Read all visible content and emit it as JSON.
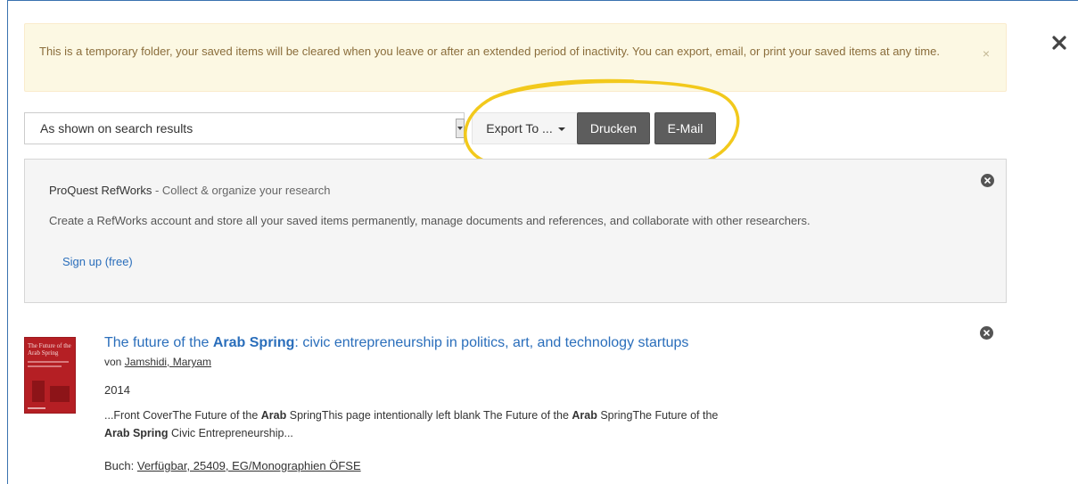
{
  "notice": {
    "text": "This is a temporary folder, your saved items will be cleared when you leave or after an extended period of inactivity. You can export, email, or print your saved items at any time.",
    "dismiss_glyph": "×"
  },
  "toolbar": {
    "format_selected": "As shown on search results",
    "export_label": "Export To ...",
    "print_label": "Drucken",
    "email_label": "E-Mail"
  },
  "refworks": {
    "brand": "ProQuest RefWorks",
    "tagline": " - Collect & organize your research",
    "description": "Create a RefWorks account and store all your saved items permanently, manage documents and references, and collaborate with other researchers.",
    "signup_label": "Sign up (free)"
  },
  "result": {
    "cover_text": "The Future of the Arab Spring",
    "title_pre": "The future of the ",
    "title_highlight": "Arab Spring",
    "title_post": ": civic entrepreneurship in politics, art, and technology startups",
    "author_prefix": "von ",
    "author": "Jamshidi, Maryam",
    "year": "2014",
    "snippet": [
      {
        "text": "...Front CoverThe Future of the ",
        "bold": false
      },
      {
        "text": "Arab",
        "bold": true
      },
      {
        "text": " SpringThis page intentionally left blank The Future of the ",
        "bold": false
      },
      {
        "text": "Arab",
        "bold": true
      },
      {
        "text": " SpringThe Future of the ",
        "bold": false
      },
      {
        "text": "Arab Spring",
        "bold": true
      },
      {
        "text": " Civic Entrepreneurship...",
        "bold": false
      }
    ],
    "availability_prefix": "Buch: ",
    "availability": "Verfügbar, 25409, EG/Monographien ÖFSE"
  },
  "colors": {
    "accent_link": "#2a6ebb",
    "notice_bg": "#fcf8e3",
    "notice_text": "#8a6d3b",
    "dark_button": "#5d5d5d",
    "highlight_ring": "#f2c91c"
  },
  "icons": {
    "modal_close": "close-icon",
    "panel_close": "circle-close-icon",
    "dropdown": "chevron-down-icon"
  }
}
